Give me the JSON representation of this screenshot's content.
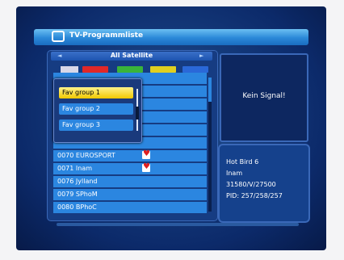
{
  "window": {
    "title": "TV-Programmliste"
  },
  "satellite": {
    "label": "All Satellite",
    "left_arrow": "◄",
    "right_arrow": "►"
  },
  "color_buttons": [
    {
      "name": "red",
      "color": "#e02828"
    },
    {
      "name": "green",
      "color": "#3ab43a"
    },
    {
      "name": "yellow",
      "color": "#e0d020"
    },
    {
      "name": "blue",
      "color": "#2a68d8"
    }
  ],
  "group_popup": {
    "items": [
      {
        "label": "Fav group 1",
        "selected": true
      },
      {
        "label": "Fav group 2",
        "selected": false
      },
      {
        "label": "Fav group 3",
        "selected": false
      }
    ]
  },
  "channels": [
    {
      "label": "",
      "fav": false
    },
    {
      "label": "",
      "fav": false
    },
    {
      "label": "",
      "fav": false
    },
    {
      "label": "",
      "fav": false
    },
    {
      "label": "",
      "fav": false
    },
    {
      "label": "",
      "fav": false
    },
    {
      "label": "0070 EUROSPORT",
      "fav": true
    },
    {
      "label": "0071 Inam",
      "fav": true
    },
    {
      "label": "0076 Jylland",
      "fav": false
    },
    {
      "label": "0079 SPhoM",
      "fav": false
    },
    {
      "label": "0080 BPhoC",
      "fav": false
    }
  ],
  "preview": {
    "status": "Kein Signal!"
  },
  "info": {
    "line1": "Hot Bird 6",
    "line2": "Inam",
    "line3": "31580/V/27500",
    "line4": "PID: 257/258/257"
  },
  "colors": {
    "accent": "#2b86e0",
    "background": "#163c82",
    "selection": "#f0c800"
  }
}
